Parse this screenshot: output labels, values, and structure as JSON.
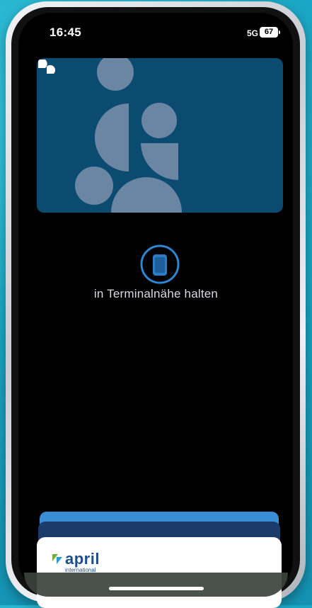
{
  "status_bar": {
    "time": "16:45",
    "network": "5G",
    "battery": "67"
  },
  "card": {
    "background_color": "#0c4b70",
    "logo_icon": "card-brand-icon"
  },
  "payment": {
    "icon": "phone-nfc-icon",
    "instruction": "in Terminalnähe halten"
  },
  "card_stack": {
    "front_card": {
      "brand": "april",
      "subtitle": "international"
    }
  },
  "colors": {
    "accent": "#2d86d1",
    "card_back": "#3a8ed6",
    "background": "#1aa7c6"
  }
}
